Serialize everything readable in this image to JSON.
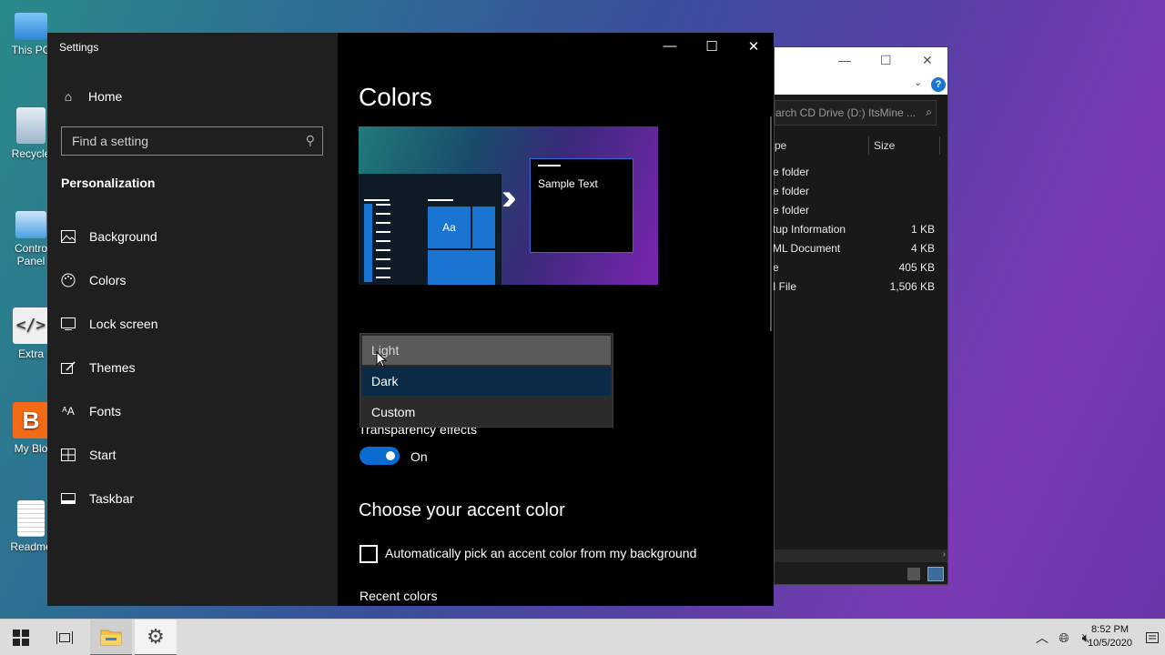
{
  "desktop": {
    "icons": [
      {
        "label": "This PC"
      },
      {
        "label": "Recycle"
      },
      {
        "label": "Contro Panel"
      },
      {
        "label": "Extra"
      },
      {
        "label": "My Blo"
      },
      {
        "label": "Readme"
      }
    ]
  },
  "explorer": {
    "search_placeholder": "arch CD Drive (D:) ItsMine ...",
    "col_type": "pe",
    "col_size": "Size",
    "rows": [
      {
        "type": "e folder",
        "size": ""
      },
      {
        "type": "e folder",
        "size": ""
      },
      {
        "type": "e folder",
        "size": ""
      },
      {
        "type": "tup Information",
        "size": "1 KB"
      },
      {
        "type": "ML Document",
        "size": "4 KB"
      },
      {
        "type": "e",
        "size": "405 KB"
      },
      {
        "type": "I File",
        "size": "1,506 KB"
      }
    ]
  },
  "settings": {
    "window_title": "Settings",
    "home_label": "Home",
    "search_placeholder": "Find a setting",
    "section_title": "Personalization",
    "nav": [
      {
        "label": "Background",
        "icon": "image-icon"
      },
      {
        "label": "Colors",
        "icon": "palette-icon"
      },
      {
        "label": "Lock screen",
        "icon": "lock-screen-icon"
      },
      {
        "label": "Themes",
        "icon": "themes-icon"
      },
      {
        "label": "Fonts",
        "icon": "fonts-icon"
      },
      {
        "label": "Start",
        "icon": "start-icon"
      },
      {
        "label": "Taskbar",
        "icon": "taskbar-icon"
      }
    ],
    "page_heading": "Colors",
    "preview_tile_text": "Aa",
    "preview_sample_text": "Sample Text",
    "mode_dropdown": {
      "options": [
        "Light",
        "Dark",
        "Custom"
      ],
      "hovered": "Light",
      "selected": "Dark"
    },
    "transparency_label": "Transparency effects",
    "transparency_state": "On",
    "accent_heading": "Choose your accent color",
    "auto_accent_label": "Automatically pick an accent color from my background",
    "recent_colors_label": "Recent colors"
  },
  "taskbar": {
    "time": "8:52 PM",
    "date": "10/5/2020"
  },
  "colors": {
    "accent": "#0a6cd0",
    "taskbar_bg": "#dcdcdc"
  }
}
